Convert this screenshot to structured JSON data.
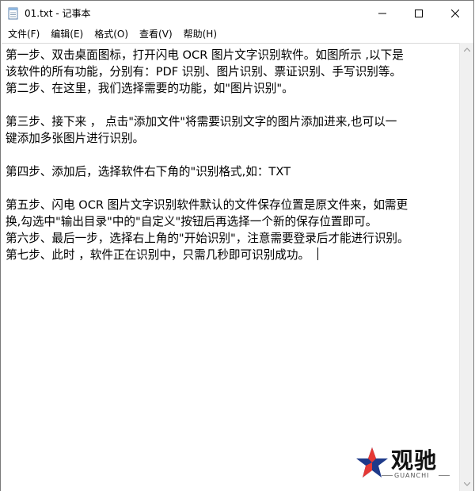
{
  "window": {
    "title": "01.txt - 记事本"
  },
  "menu": [
    {
      "label": "文件(F)"
    },
    {
      "label": "编辑(E)"
    },
    {
      "label": "格式(O)"
    },
    {
      "label": "查看(V)"
    },
    {
      "label": "帮助(H)"
    }
  ],
  "editor": {
    "lines": [
      "第一步、双击桌面图标，打开闪电 OCR 图片文字识别软件。如图所示 ,以下是",
      "该软件的所有功能，分别有：PDF 识别、图片识别、票证识别、手写识别等。",
      "第二步、在这里，我们选择需要的功能，如\"图片识别\"。",
      "",
      "第三步、接下来 ， 点击\"添加文件\"将需要识别文字的图片添加进来,也可以一",
      "键添加多张图片进行识别。",
      "",
      "第四步、添加后，选择软件右下角的\"识别格式,如：TXT",
      "",
      "第五步、闪电 OCR 图片文字识别软件默认的文件保存位置是原文件来，如需更",
      "换,勾选中\"输出目录\"中的\"自定义\"按钮后再选择一个新的保存位置即可。",
      "第六步、最后一步，选择右上角的\"开始识别\"，注意需要登录后才能进行识别。",
      "第七步、此时 ，软件正在识别中，只需几秒即可识别成功。"
    ]
  },
  "watermark": {
    "brand": "观驰",
    "sub": "GUANCHI",
    "icon": "star-logo-icon"
  },
  "colors": {
    "accent_red": "#e53935",
    "accent_blue": "#1e3a8a"
  }
}
